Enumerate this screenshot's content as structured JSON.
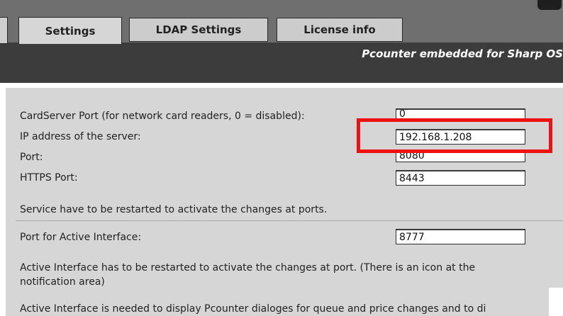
{
  "tabs": [
    {
      "label": "Settings",
      "active": true
    },
    {
      "label": "LDAP Settings",
      "active": false
    },
    {
      "label": "License info",
      "active": false
    }
  ],
  "header": {
    "subtitle": "Pcounter embedded for Sharp OS"
  },
  "fields": {
    "cardserver_port": {
      "label": "CardServer Port (for network card readers, 0 = disabled):",
      "value": "0"
    },
    "ip_address": {
      "label": "IP address of the server:",
      "value": "192.168.1.208"
    },
    "port": {
      "label": "Port:",
      "value": "8080"
    },
    "https_port": {
      "label": "HTTPS Port:",
      "value": "8443"
    },
    "active_interface_port": {
      "label": "Port for Active Interface:",
      "value": "8777"
    }
  },
  "notes": {
    "service_restart": "Service have to be restarted to activate the changes at ports.",
    "ai_restart_line1": "Active Interface has to be restarted to activate the changes at port. (There is an icon at the",
    "ai_restart_line2": "notification area)",
    "ai_needed": "Active Interface is needed to display Pcounter dialoges for queue and price changes and to di"
  },
  "colors": {
    "header_bg": "#3c3c3c",
    "content_bg": "#d6d6d6",
    "highlight": "#ee1111"
  }
}
